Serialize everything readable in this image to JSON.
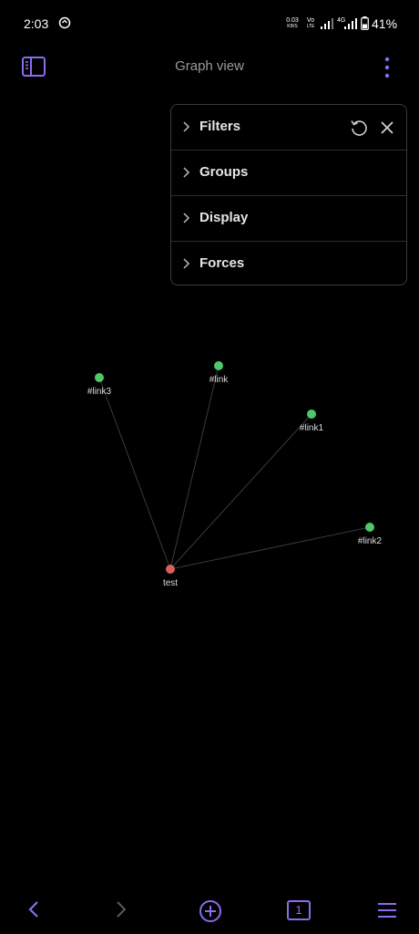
{
  "status_bar": {
    "time": "2:03",
    "net_speed": "0.03",
    "net_unit": "KB/S",
    "volte_top": "Vo",
    "volte_bottom": "LTE",
    "network_type": "4G",
    "battery": "41%"
  },
  "header": {
    "title": "Graph view",
    "sidebar_icon": "sidebar-toggle-icon",
    "more_icon": "more-vertical-icon"
  },
  "settings_panel": {
    "sections": [
      {
        "label": "Filters"
      },
      {
        "label": "Groups"
      },
      {
        "label": "Display"
      },
      {
        "label": "Forces"
      }
    ],
    "reset_icon": "reset-icon",
    "close_icon": "close-icon"
  },
  "graph": {
    "center_node": {
      "label": "test",
      "color": "#d9605e"
    },
    "linked_nodes": [
      {
        "label": "#link3",
        "color": "#4ec969"
      },
      {
        "label": "#link",
        "color": "#4ec969"
      },
      {
        "label": "#link1",
        "color": "#4ec969"
      },
      {
        "label": "#link2",
        "color": "#4ec969"
      }
    ]
  },
  "bottom_nav": {
    "back_icon": "chevron-left-icon",
    "forward_icon": "chevron-right-icon",
    "new_note_icon": "plus-circle-icon",
    "tab_count": "1",
    "menu_icon": "menu-icon"
  },
  "colors": {
    "accent": "#8b6cef",
    "background": "#000000",
    "edge": "#3a3a3a"
  }
}
